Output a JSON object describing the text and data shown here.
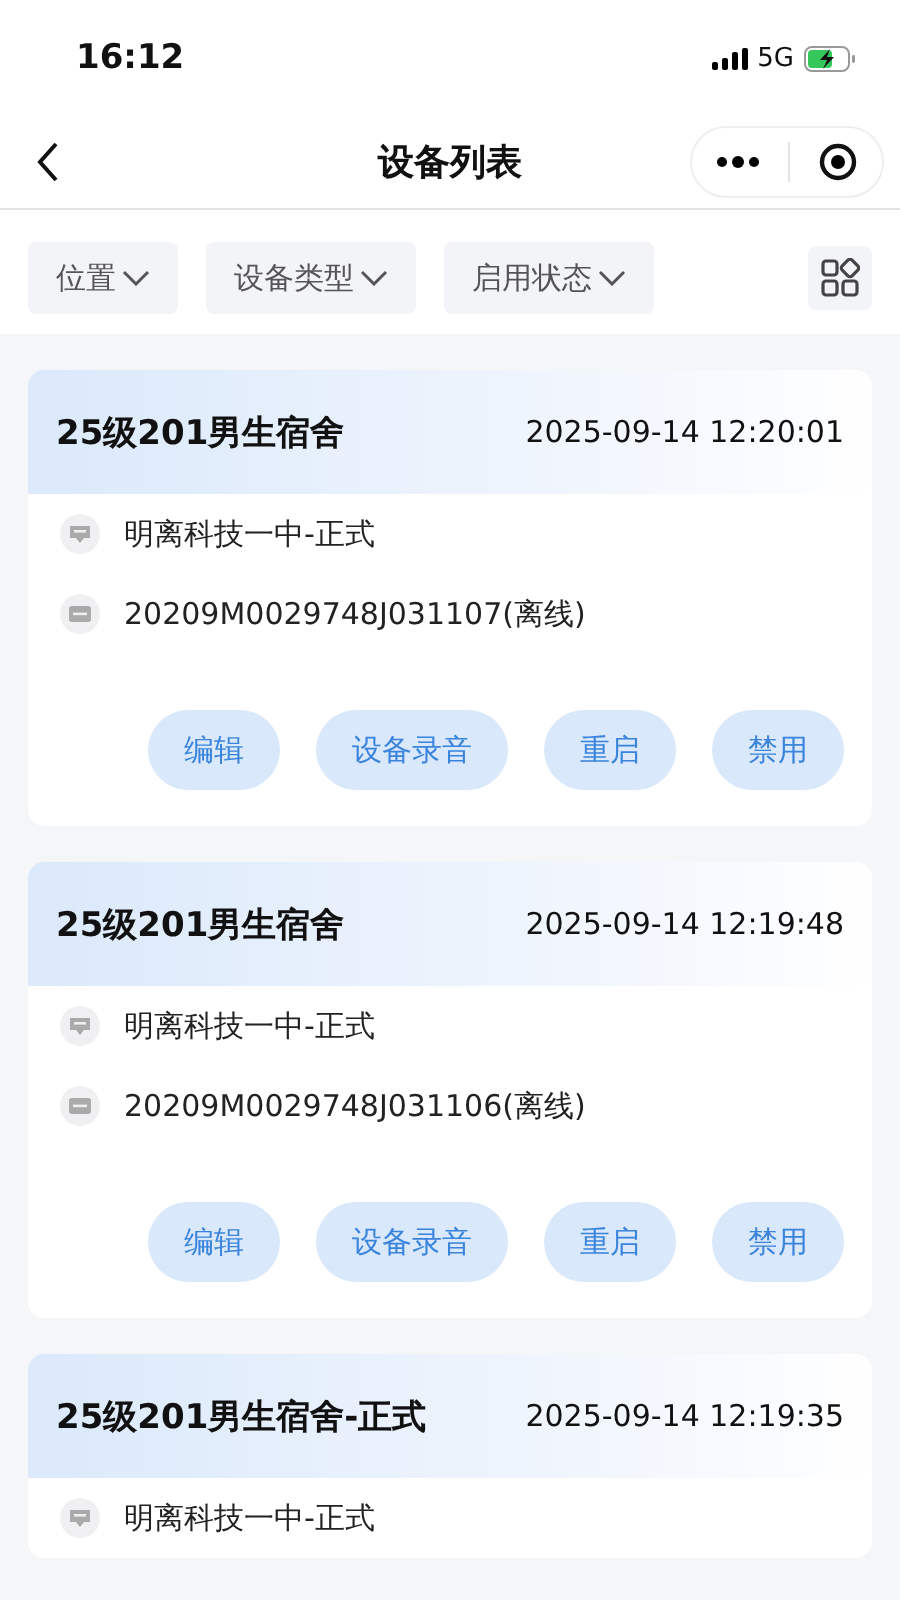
{
  "status_bar": {
    "time": "16:12",
    "network": "5G"
  },
  "nav": {
    "title": "设备列表"
  },
  "filters": [
    {
      "label": "位置"
    },
    {
      "label": "设备类型"
    },
    {
      "label": "启用状态"
    }
  ],
  "devices": [
    {
      "name": "25级201男生宿舍",
      "time": "2025-09-14 12:20:01",
      "school": "明离科技一中-正式",
      "serial": "20209M0029748J031107(离线)",
      "actions": [
        "编辑",
        "设备录音",
        "重启",
        "禁用"
      ]
    },
    {
      "name": "25级201男生宿舍",
      "time": "2025-09-14 12:19:48",
      "school": "明离科技一中-正式",
      "serial": "20209M0029748J031106(离线)",
      "actions": [
        "编辑",
        "设备录音",
        "重启",
        "禁用"
      ]
    },
    {
      "name": "25级201男生宿舍-正式",
      "time": "2025-09-14 12:19:35",
      "school": "明离科技一中-正式"
    }
  ]
}
